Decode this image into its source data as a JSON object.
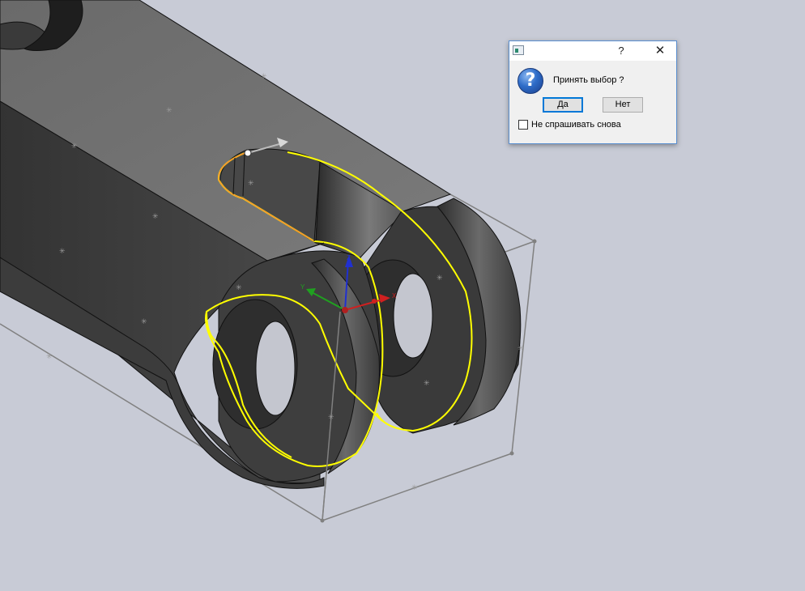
{
  "dialog": {
    "help_label": "?",
    "close_label": "✕",
    "icon": "question-icon",
    "message": "Принять выбор ?",
    "yes_label": "Да",
    "no_label": "Нет",
    "checkbox_label": "Не спрашивать снова",
    "checkbox_checked": false
  },
  "viewport": {
    "triad_axes": [
      "Z",
      "Y",
      "X"
    ],
    "colors": {
      "background": "#c8cbd6",
      "part_top": "#6e6e6e",
      "part_side": "#3f3f3f",
      "selection": "#ffff00",
      "bounding_box": "#808080",
      "axis_x": "#d02020",
      "axis_y": "#20a020",
      "axis_z": "#2030d0"
    }
  }
}
